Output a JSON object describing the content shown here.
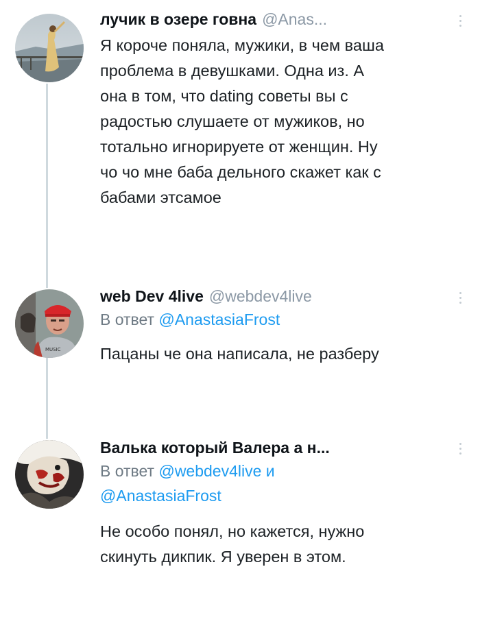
{
  "tweets": [
    {
      "name": "лучик в озере говна",
      "handle": "@Anas...",
      "avatar_icon": "profile-photo-woman-dress",
      "text": "Я короче поняла, мужики, в чем ваша\nпроблема в девушками. Одна из. А\nона в том, что dating советы вы с\nрадостью слушаете от мужиков, но\nтотально игнорируете от женщин. Ну\nчо чо мне баба дельного скажет как с\nбабами этсамое"
    },
    {
      "name": "web Dev 4live",
      "handle": "@webdev4live",
      "avatar_icon": "profile-photo-man-red-cap",
      "reply_prefix": "В ответ ",
      "reply_mention": "@AnastasiaFrost",
      "text": "Пацаны че она написала, не разберу"
    },
    {
      "name": "Валька который Валера а н...",
      "avatar_icon": "profile-photo-dark-art",
      "reply_prefix": "В ответ ",
      "reply_mention_1": "@webdev4live",
      "reply_and": " и",
      "reply_mention_2": "@AnastasiaFrost",
      "text": "Не особо понял, но кажется, нужно\nскинуть дикпик. Я уверен в этом."
    }
  ]
}
